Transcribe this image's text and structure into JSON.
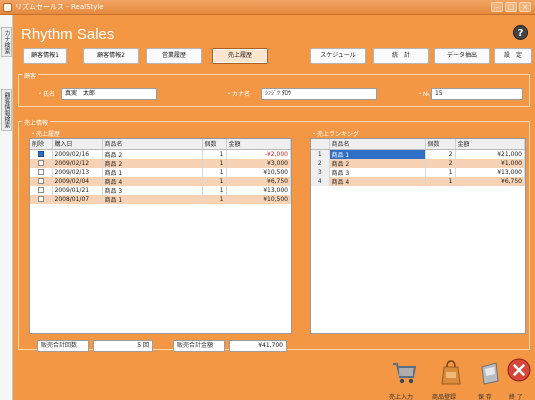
{
  "window": {
    "title": "リズムセールス - RealStyle"
  },
  "left_tabs": [
    "カナ検索",
    "顧客情報検索"
  ],
  "header": {
    "app_title": "Rhythm Sales",
    "help_label": "?"
  },
  "tabs": [
    "顧客情報1",
    "顧客情報2",
    "営業履歴",
    "売上履歴",
    "スケジュール",
    "統　計",
    "データ抽出",
    "設　定"
  ],
  "customer": {
    "legend": "顧客",
    "name_label": "・氏名",
    "name_value": "真実　太郎",
    "kana_label": "・カナ名",
    "kana_value": "ｼﾝｼﾞﾂ ﾀﾛｳ",
    "no_label": "・№",
    "no_value": "15"
  },
  "sales": {
    "legend": "売上情報",
    "history": {
      "title": "・売上履歴",
      "headers": [
        "削除",
        "購入日",
        "商品名",
        "個数",
        "金額"
      ],
      "rows": [
        {
          "checked": true,
          "date": "2009/02/16",
          "product": "商品 2",
          "qty": "1",
          "amount": "-¥2,000",
          "red": true
        },
        {
          "checked": false,
          "date": "2009/02/12",
          "product": "商品 2",
          "qty": "1",
          "amount": "¥3,000"
        },
        {
          "checked": false,
          "date": "2009/02/13",
          "product": "商品 1",
          "qty": "1",
          "amount": "¥10,500"
        },
        {
          "checked": false,
          "date": "2009/02/04",
          "product": "商品 4",
          "qty": "1",
          "amount": "¥6,750"
        },
        {
          "checked": false,
          "date": "2009/01/21",
          "product": "商品 3",
          "qty": "1",
          "amount": "¥13,000"
        },
        {
          "checked": false,
          "date": "2008/01/07",
          "product": "商品 1",
          "qty": "1",
          "amount": "¥10,500"
        }
      ]
    },
    "ranking": {
      "title": "・売上ランキング",
      "headers": [
        "",
        "商品名",
        "個数",
        "金額"
      ],
      "rows": [
        {
          "rank": "1",
          "product": "商品 1",
          "qty": "2",
          "amount": "¥21,000"
        },
        {
          "rank": "2",
          "product": "商品 2",
          "qty": "2",
          "amount": "¥1,000"
        },
        {
          "rank": "3",
          "product": "商品 3",
          "qty": "1",
          "amount": "¥13,000"
        },
        {
          "rank": "4",
          "product": "商品 4",
          "qty": "1",
          "amount": "¥6,750"
        }
      ]
    },
    "totals": {
      "count_label": "販売合計回数",
      "count_value": "5 回",
      "amount_label": "販売合計金額",
      "amount_value": "¥41,700"
    }
  },
  "toolbar": {
    "sales_input_label": "売上入力",
    "product_register_label": "商品登録",
    "save_label": "保 存",
    "exit_label": "終 了"
  },
  "colors": {
    "accent": "#f39744",
    "selected": "#2f6fc6",
    "row_alt": "#f8d2b4",
    "negative": "#d22020"
  }
}
